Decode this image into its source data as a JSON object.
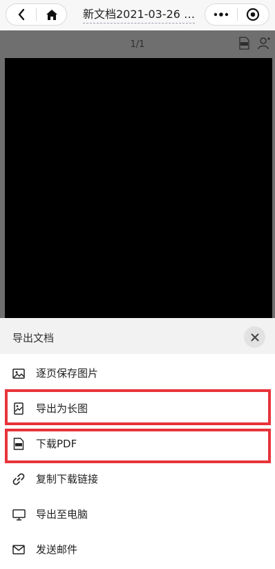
{
  "navbar": {
    "title": "新文档2021-03-26 …",
    "back_icon": "chevron-left-icon",
    "home_icon": "home-icon",
    "more_icon": "more-dots-icon",
    "record_icon": "target-icon"
  },
  "preview": {
    "page_indicator": "1/1",
    "tools": [
      "pdf-icon",
      "user-share-icon"
    ]
  },
  "sheet": {
    "title": "导出文档",
    "close_icon": "close-icon",
    "items": [
      {
        "label": "逐页保存图片",
        "icon": "image-icon"
      },
      {
        "label": "导出为长图",
        "icon": "long-image-icon"
      },
      {
        "label": "下载PDF",
        "icon": "pdf-file-icon"
      },
      {
        "label": "复制下载链接",
        "icon": "link-icon"
      },
      {
        "label": "导出至电脑",
        "icon": "monitor-icon"
      },
      {
        "label": "发送邮件",
        "icon": "mail-icon"
      }
    ]
  },
  "colors": {
    "highlight": "#e8333a",
    "dim_overlay": "#6f6f6f",
    "document_page": "#000000"
  }
}
